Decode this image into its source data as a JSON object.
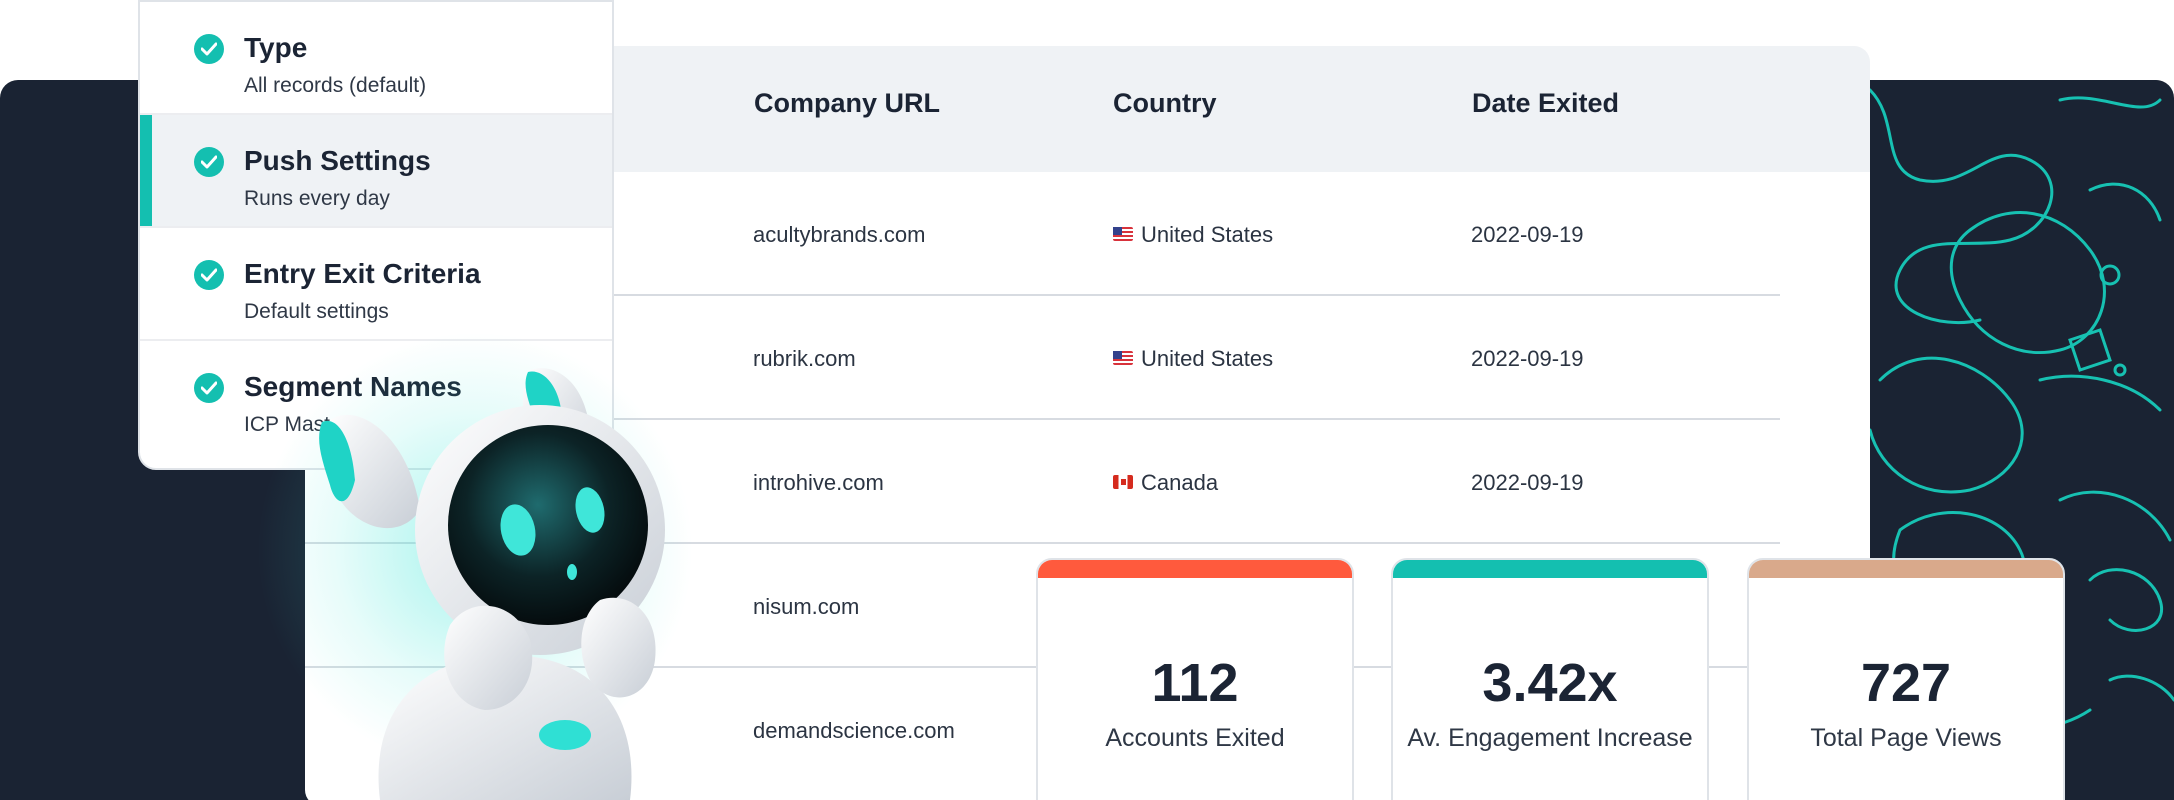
{
  "colors": {
    "navy": "#1a2333",
    "teal": "#14bfb0",
    "coral": "#ff5a3d",
    "sand": "#d9a98b"
  },
  "steps": [
    {
      "title": "Type",
      "subtitle": "All records (default)",
      "active": false
    },
    {
      "title": "Push Settings",
      "subtitle": "Runs every day",
      "active": true
    },
    {
      "title": "Entry Exit Criteria",
      "subtitle": "Default settings",
      "active": false
    },
    {
      "title": "Segment Names",
      "subtitle": "ICP Mast",
      "active": false
    }
  ],
  "table": {
    "headers": [
      "Company URL",
      "Country",
      "Date Exited"
    ],
    "rows": [
      {
        "url": "acultybrands.com",
        "country": "United States",
        "flag": "us-flag-icon",
        "date": "2022-09-19"
      },
      {
        "url": "rubrik.com",
        "country": "United States",
        "flag": "us-flag-icon",
        "date": "2022-09-19"
      },
      {
        "url": "introhive.com",
        "country": "Canada",
        "flag": "ca-flag-icon",
        "date": "2022-09-19"
      },
      {
        "url": "nisum.com",
        "country": "",
        "flag": "",
        "date": ""
      },
      {
        "url": "demandscience.com",
        "country": "",
        "flag": "",
        "date": ""
      }
    ]
  },
  "stats": [
    {
      "value": "112",
      "label": "Accounts Exited",
      "color": "#ff5a3d"
    },
    {
      "value": "3.42x",
      "label": "Av. Engagement Increase",
      "color": "#14bfb0"
    },
    {
      "value": "727",
      "label": "Total Page Views",
      "color": "#d9a98b"
    }
  ],
  "illustration": {
    "robot": "robot-mascot-icon",
    "pattern": "doodle-pattern"
  }
}
